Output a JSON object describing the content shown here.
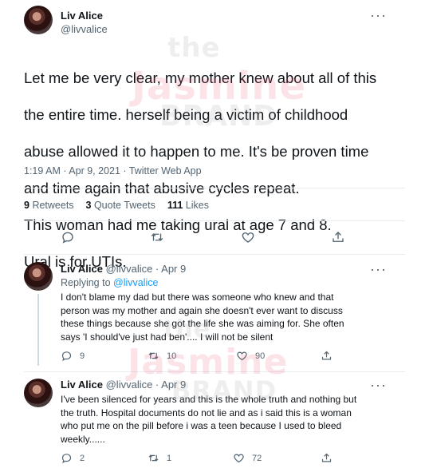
{
  "main_tweet": {
    "author_name": "Liv Alice",
    "handle": "@livvalice",
    "text_lines": [
      "Let me be very clear, my mother knew about all of this",
      "the entire time. herself being a victim of childhood",
      "abuse allowed it to happen to me. It's be proven time",
      "and time again that abusive cycles repeat.",
      "This woman had me taking ural at age 7 and 8.",
      "Ural is for UTIs."
    ],
    "timestamp": "1:19 AM · Apr 9, 2021 · Twitter Web App",
    "retweets_count": "9",
    "retweets_label": "Retweets",
    "quote_count": "3",
    "quote_label": "Quote Tweets",
    "likes_count": "111",
    "likes_label": "Likes"
  },
  "replies": [
    {
      "author_name": "Liv Alice",
      "handle_date": "@livvalice · Apr 9",
      "replying_prefix": "Replying to",
      "replying_to": "@livvalice",
      "text": "I don't blame my dad but there was someone who knew and that\nperson was my mother and again she doesn't ever want to discuss\nthese things because she got the life she was aiming for. She often\nsays 'I should've just had ben'.... I will not be silent",
      "reply_count": "9",
      "retweet_count": "10",
      "like_count": "90"
    },
    {
      "author_name": "Liv Alice",
      "handle_date": "@livvalice · Apr 9",
      "text": "I've been silenced for years and this is the whole truth and nothing but\nthe truth. Hospital documents do not lie and as i said this is a woman\nwho put me on the pill before i was a teen because I used to bleed\nweekly......",
      "reply_count": "2",
      "retweet_count": "1",
      "like_count": "72"
    }
  ],
  "more_glyph": "···",
  "watermark": {
    "word1": "the",
    "word2": "Jasmine",
    "word3": "BRAND"
  },
  "colors": {
    "accent": "#1d9bf0",
    "secondary_text": "#536471",
    "divider": "#e6ecf0"
  }
}
